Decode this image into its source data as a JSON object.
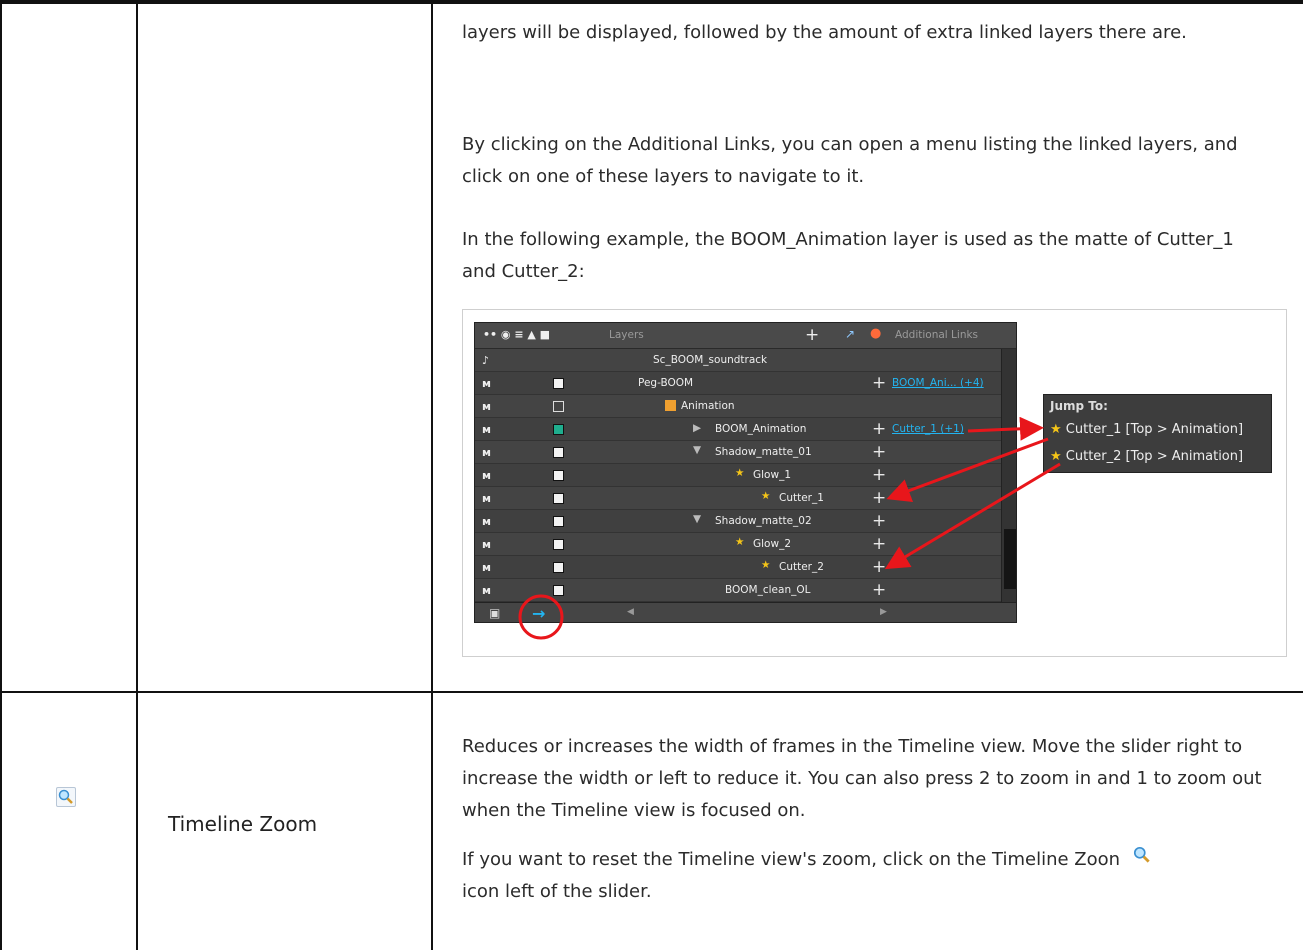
{
  "row1": {
    "description": [
      "layers will be displayed, followed by the amount of extra linked layers there are.",
      "By clicking on the Additional Links, you can open a menu listing the linked layers, and click on one of these layers to navigate to it.",
      "In the following example, the BOOM_Animation layer is used as the matte of Cutter_1 and Cutter_2:"
    ],
    "panel": {
      "header": {
        "layers_label": "Layers",
        "links_label": "Additional Links"
      },
      "rows": [
        {
          "name": "Sc_BOOM_soundtrack",
          "link": ""
        },
        {
          "name": "Peg-BOOM",
          "link": "BOOM_Ani... (+4)"
        },
        {
          "name": "Animation",
          "link": ""
        },
        {
          "name": "BOOM_Animation",
          "link": "Cutter_1 (+1)"
        },
        {
          "name": "Shadow_matte_01",
          "link": ""
        },
        {
          "name": "Glow_1",
          "link": ""
        },
        {
          "name": "Cutter_1",
          "link": ""
        },
        {
          "name": "Shadow_matte_02",
          "link": ""
        },
        {
          "name": "Glow_2",
          "link": ""
        },
        {
          "name": "Cutter_2",
          "link": ""
        },
        {
          "name": "BOOM_clean_OL",
          "link": ""
        }
      ]
    },
    "jump_menu": {
      "title": "Jump To:",
      "items": [
        "Cutter_1 [Top > Animation]",
        "Cutter_2 [Top > Animation]"
      ]
    }
  },
  "row2": {
    "name": "Timeline Zoom",
    "icon": "zoom-magnifier-icon",
    "description": [
      "Reduces or increases the width of frames in the Timeline view. Move the slider right to increase the width or left to reduce it. You can also press 2 to zoom in and 1 to zoom out when the Timeline view is focused on.",
      "If you want to reset the Timeline view's zoom, click on the Timeline Zoon",
      "icon left of the slider."
    ]
  },
  "colors": {
    "link": "#23b4f0",
    "arrow": "#e8161b",
    "star": "#f5c518",
    "panel_bg": "#3c3c3c"
  }
}
